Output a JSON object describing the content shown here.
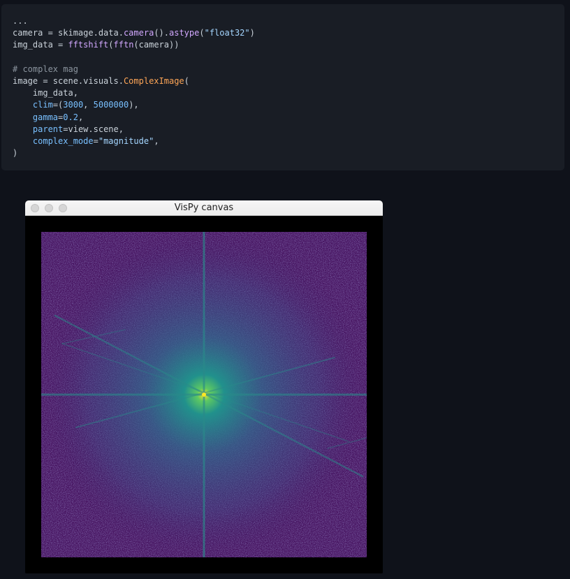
{
  "code": {
    "lines": [
      [
        {
          "t": "...",
          "c": ""
        }
      ],
      [
        {
          "t": "camera = skimage.data.",
          "c": ""
        },
        {
          "t": "camera",
          "c": "fn"
        },
        {
          "t": "().",
          "c": ""
        },
        {
          "t": "astype",
          "c": "fn"
        },
        {
          "t": "(",
          "c": ""
        },
        {
          "t": "\"float32\"",
          "c": "str"
        },
        {
          "t": ")",
          "c": ""
        }
      ],
      [
        {
          "t": "img_data = ",
          "c": ""
        },
        {
          "t": "fftshift",
          "c": "fn"
        },
        {
          "t": "(",
          "c": ""
        },
        {
          "t": "fftn",
          "c": "fn"
        },
        {
          "t": "(camera))",
          "c": ""
        }
      ],
      [
        {
          "t": "",
          "c": ""
        }
      ],
      [
        {
          "t": "# complex mag",
          "c": "cm"
        }
      ],
      [
        {
          "t": "image = scene.visuals.",
          "c": ""
        },
        {
          "t": "ComplexImage",
          "c": "cls"
        },
        {
          "t": "(",
          "c": ""
        }
      ],
      [
        {
          "t": "    img_data,",
          "c": ""
        }
      ],
      [
        {
          "t": "    ",
          "c": ""
        },
        {
          "t": "clim",
          "c": "kw"
        },
        {
          "t": "=(",
          "c": ""
        },
        {
          "t": "3000",
          "c": "num"
        },
        {
          "t": ", ",
          "c": ""
        },
        {
          "t": "5000000",
          "c": "num"
        },
        {
          "t": "),",
          "c": ""
        }
      ],
      [
        {
          "t": "    ",
          "c": ""
        },
        {
          "t": "gamma",
          "c": "kw"
        },
        {
          "t": "=",
          "c": ""
        },
        {
          "t": "0.2",
          "c": "num"
        },
        {
          "t": ",",
          "c": ""
        }
      ],
      [
        {
          "t": "    ",
          "c": ""
        },
        {
          "t": "parent",
          "c": "kw"
        },
        {
          "t": "=view.scene,",
          "c": ""
        }
      ],
      [
        {
          "t": "    ",
          "c": ""
        },
        {
          "t": "complex_mode",
          "c": "kw"
        },
        {
          "t": "=",
          "c": ""
        },
        {
          "t": "\"magnitude\"",
          "c": "str"
        },
        {
          "t": ",",
          "c": ""
        }
      ],
      [
        {
          "t": ")",
          "c": ""
        }
      ]
    ]
  },
  "window": {
    "title": "VisPy canvas"
  },
  "colors": {
    "page_bg": "#0f121a",
    "code_bg": "#191d25",
    "spectrum_bg": "#45115e",
    "spectrum_mid": "#2f6d8e",
    "spectrum_center": "#fde725"
  },
  "icons": {
    "window_controls": [
      "close-dot-icon",
      "minimize-dot-icon",
      "zoom-dot-icon"
    ]
  }
}
